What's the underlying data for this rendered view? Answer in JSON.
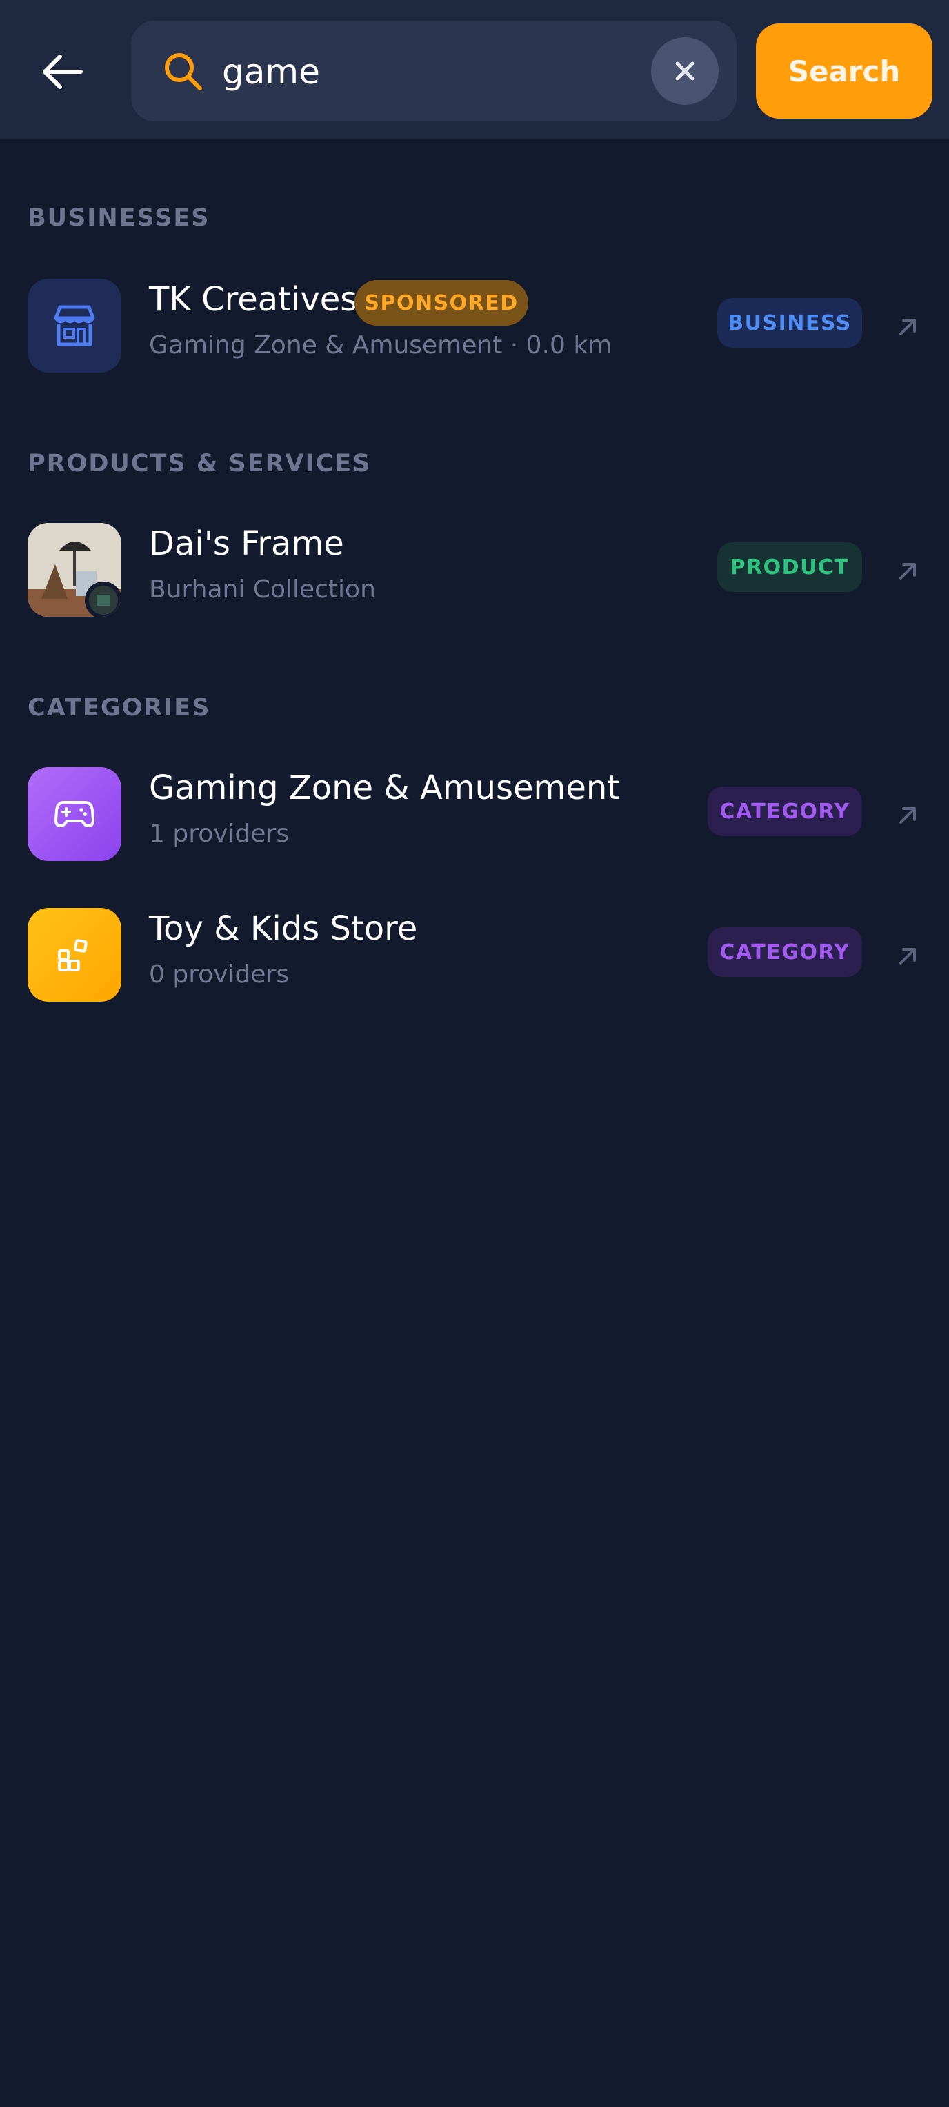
{
  "search": {
    "query": "game",
    "button_label": "Search"
  },
  "sections": {
    "businesses": "BUSINESSES",
    "products": "PRODUCTS & SERVICES",
    "categories": "CATEGORIES"
  },
  "business_results": [
    {
      "title": "TK Creatives",
      "sponsored_label": "SPONSORED",
      "subtitle": "Gaming Zone & Amusement · 0.0 km",
      "badge": "BUSINESS",
      "icon": "storefront-icon"
    }
  ],
  "product_results": [
    {
      "title": "Dai's Frame",
      "subtitle": "Burhani Collection",
      "badge": "PRODUCT"
    }
  ],
  "category_results": [
    {
      "title": "Gaming Zone & Amusement",
      "subtitle": "1 providers",
      "badge": "CATEGORY",
      "icon": "gamepad-icon"
    },
    {
      "title": "Toy & Kids Store",
      "subtitle": "0 providers",
      "badge": "CATEGORY",
      "icon": "blocks-icon"
    }
  ],
  "colors": {
    "background": "#131a2e",
    "header": "#1e2840",
    "accent": "#ff9d0a",
    "business_badge": "#4f8df5",
    "product_badge": "#2ec27e",
    "category_badge": "#a259f0",
    "toy_icon_bg": "#ffb800"
  }
}
